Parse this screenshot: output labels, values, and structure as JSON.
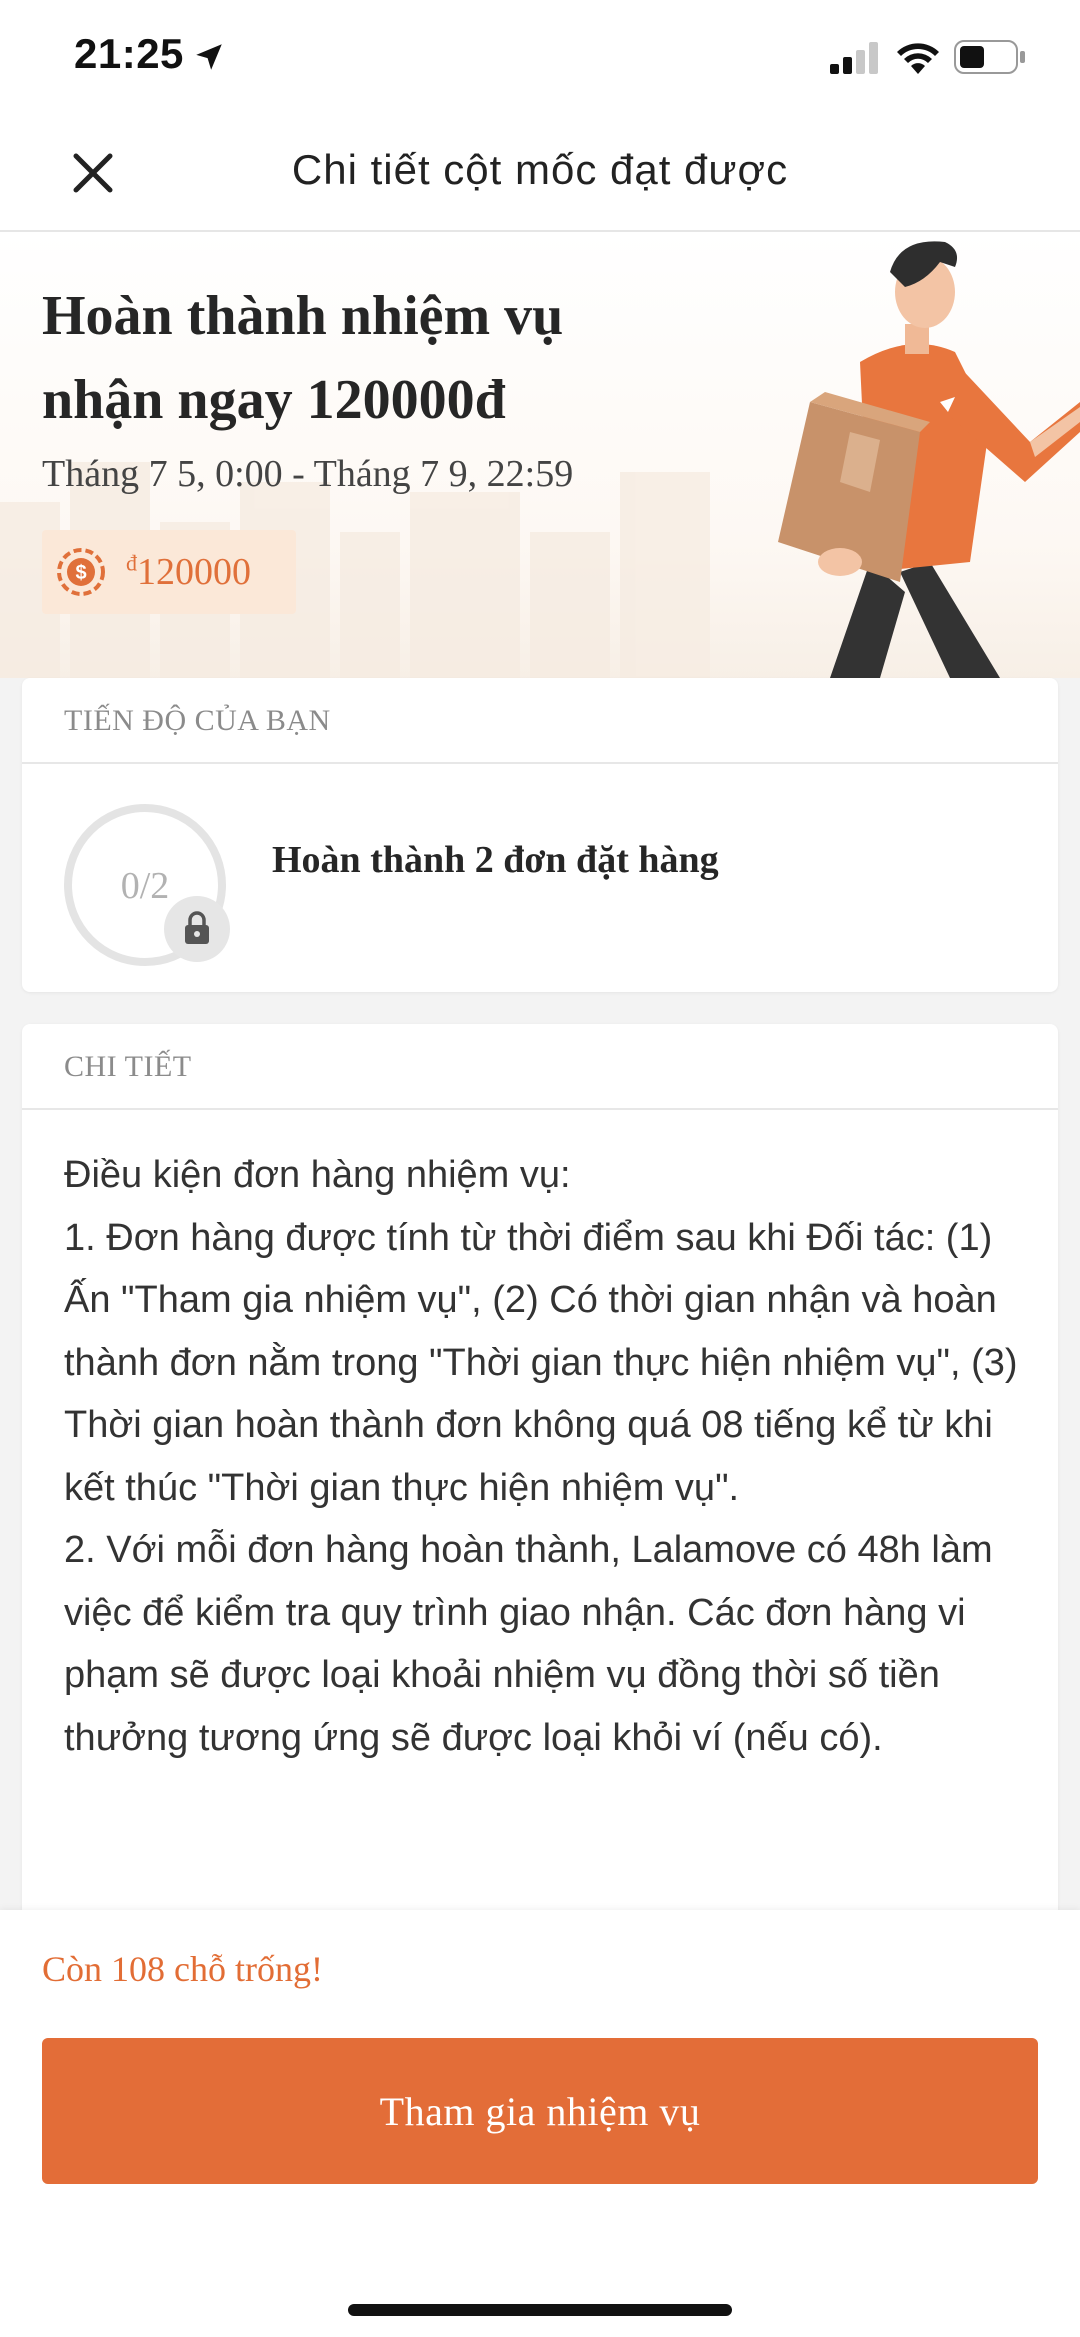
{
  "status_bar": {
    "time": "21:25",
    "icons": [
      "location-arrow-icon",
      "signal-icon",
      "wifi-icon",
      "battery-icon"
    ]
  },
  "nav": {
    "title": "Chi tiết cột mốc đạt được",
    "close_icon": "close-icon"
  },
  "hero": {
    "title": "Hoàn thành nhiệm vụ nhận ngay 120000đ",
    "date_range": "Tháng 7 5, 0:00 - Tháng 7 9, 22:59",
    "reward_currency": "đ",
    "reward_amount": "120000"
  },
  "progress": {
    "header": "TIẾN ĐỘ CỦA BẠN",
    "value": "0/2",
    "label": "Hoàn thành 2 đơn đặt hàng"
  },
  "detail": {
    "header": "CHI TIẾT",
    "lines": [
      "Điều kiện đơn hàng nhiệm vụ:",
      "1. Đơn hàng được tính từ thời điểm sau khi Đối tác: (1) Ấn \"Tham gia nhiệm vụ\", (2) Có thời gian nhận và hoàn thành đơn nằm trong \"Thời gian thực hiện nhiệm vụ\", (3) Thời gian hoàn thành đơn không quá 08 tiếng kể từ khi kết thúc \"Thời gian thực hiện nhiệm vụ\".",
      "2. Với mỗi đơn hàng hoàn thành, Lalamove có 48h làm việc để kiểm tra quy trình giao nhận. Các đơn hàng vi phạm sẽ được loại khoải nhiệm vụ đồng thời số tiền thưởng tương ứng sẽ được loại khỏi ví (nếu có)."
    ]
  },
  "footer": {
    "slots_text": "Còn 108 chỗ trống!",
    "button_label": "Tham gia nhiệm vụ"
  },
  "colors": {
    "accent": "#e36d38",
    "reward_chip_bg": "#fbe8d8"
  }
}
